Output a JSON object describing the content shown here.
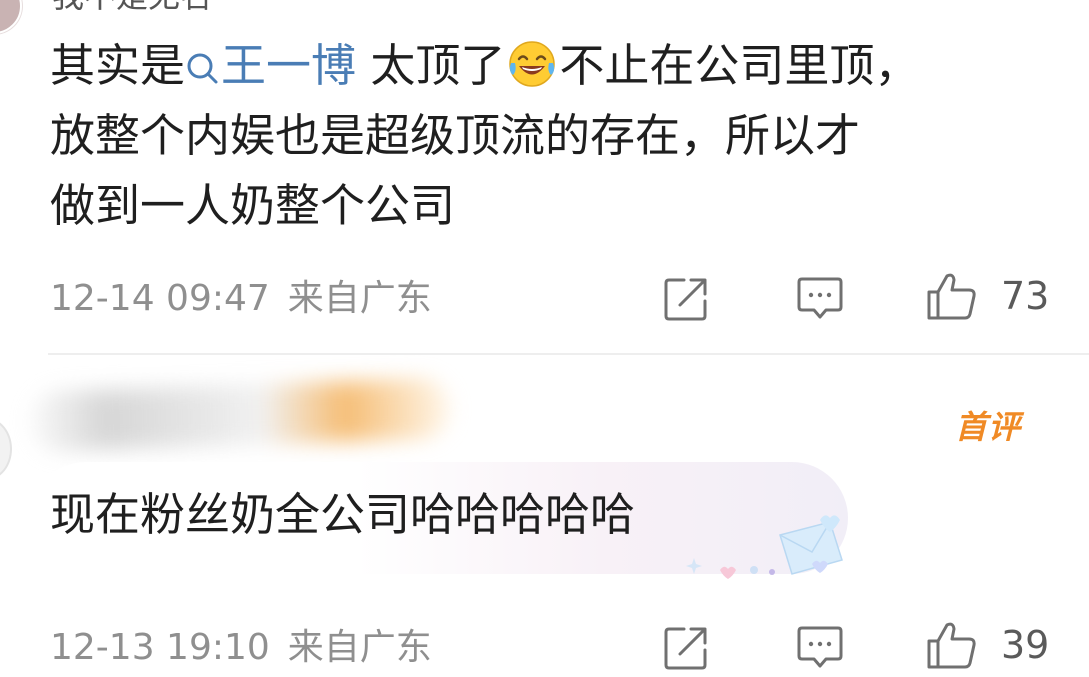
{
  "comments": [
    {
      "username": "我不是无名",
      "text": {
        "line1_before": "其实是",
        "mention": "王一博",
        "line1_mid": " 太顶了",
        "line1_after": "不止在公司里顶，",
        "line2": "放整个内娱也是超级顶流的存在，所以才",
        "line3": "做到一人奶整个公司"
      },
      "date": "12-14 09:47",
      "location": "来自广东",
      "likes": "73"
    },
    {
      "username": "",
      "badge": "首评",
      "text": "现在粉丝奶全公司哈哈哈哈哈",
      "date": "12-13 19:10",
      "location": "来自广东",
      "likes": "39"
    }
  ],
  "icons": {
    "share": "share-icon",
    "comment": "comment-icon",
    "like": "thumbs-up-icon",
    "mention": "search-icon",
    "emoji": "laughing-tears-emoji"
  },
  "colors": {
    "mention": "#4a7db5",
    "badge": "#f08a25",
    "meta": "#8f8f8f"
  }
}
